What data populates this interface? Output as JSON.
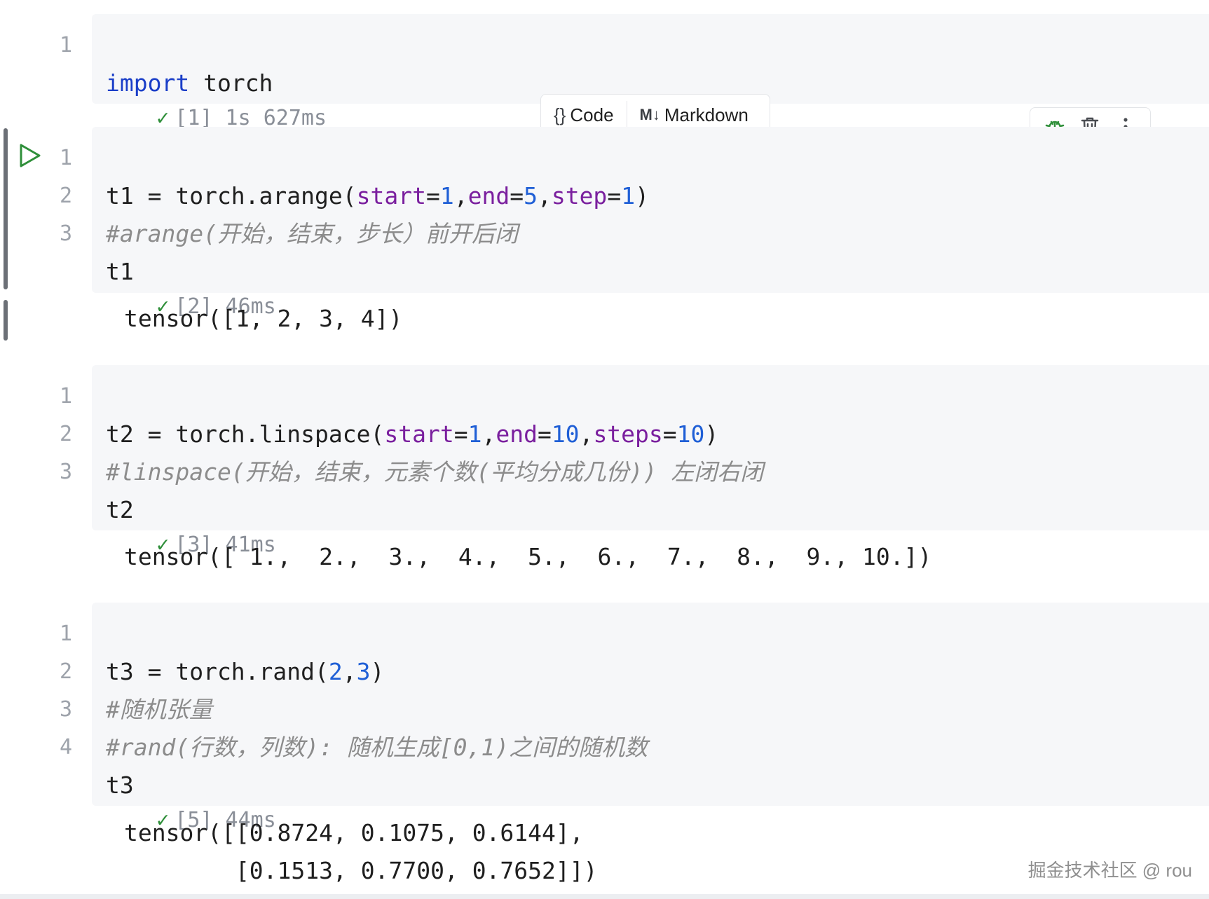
{
  "insert_bar": {
    "code_icon": "{}",
    "code_label": "Code",
    "markdown_icon": "M↓",
    "markdown_label": "Markdown"
  },
  "cell_toolbar": {
    "icons": [
      "debug-icon",
      "trash-icon",
      "more-vertical-icon"
    ]
  },
  "cells": [
    {
      "lines": [
        "1"
      ],
      "code": [
        "import torch"
      ],
      "status_check": "✓",
      "status_text": "[1] 1s 627ms",
      "output": []
    },
    {
      "lines": [
        "1",
        "2",
        "3"
      ],
      "code": [
        "t1 = torch.arange(start=1,end=5,step=1)",
        "#arange(开始，结束，步长）前开后闭",
        "t1"
      ],
      "status_check": "✓",
      "status_text": "[2] 46ms",
      "output": [
        "tensor([1, 2, 3, 4])"
      ]
    },
    {
      "lines": [
        "1",
        "2",
        "3"
      ],
      "code": [
        "t2 = torch.linspace(start=1,end=10,steps=10)",
        "#linspace(开始，结束，元素个数(平均分成几份)) 左闭右闭",
        "t2"
      ],
      "status_check": "✓",
      "status_text": "[3] 41ms",
      "output": [
        "tensor([ 1.,  2.,  3.,  4.,  5.,  6.,  7.,  8.,  9., 10.])"
      ]
    },
    {
      "lines": [
        "1",
        "2",
        "3",
        "4"
      ],
      "code": [
        "t3 = torch.rand(2,3)",
        "#随机张量",
        "#rand(行数，列数): 随机生成[0,1)之间的随机数",
        "t3"
      ],
      "status_check": "✓",
      "status_text": "[5] 44ms",
      "output": [
        "tensor([[0.8724, 0.1075, 0.6144],",
        "        [0.1513, 0.7700, 0.7652]])"
      ]
    }
  ],
  "watermark": "掘金技术社区 @ rou",
  "colors": {
    "cell_bg": "#f6f7f9",
    "keyword": "#1a3ec8",
    "kwarg": "#7a1f9e",
    "number": "#1f5fd6",
    "comment": "#8c8c8c",
    "success": "#2f8f3a",
    "run": "#2f8f3a"
  }
}
